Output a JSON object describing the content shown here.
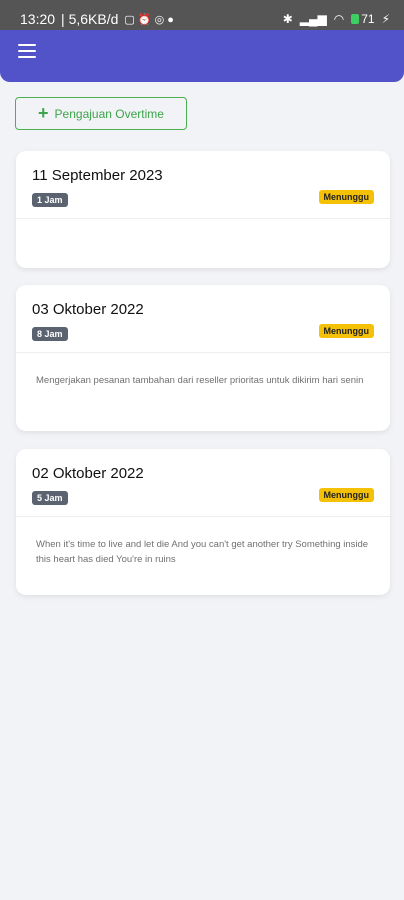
{
  "status_bar": {
    "time": "13:20",
    "network": "| 5,6KB/d",
    "battery": "71"
  },
  "toolbar": {
    "add_label": "Pengajuan Overtime"
  },
  "requests": [
    {
      "date": "11 September 2023",
      "hours": "1 Jam",
      "status": "Menunggu",
      "note": ""
    },
    {
      "date": "03 Oktober 2022",
      "hours": "8 Jam",
      "status": "Menunggu",
      "note": "Mengerjakan pesanan tambahan dari reseller prioritas untuk dikirim hari senin"
    },
    {
      "date": "02 Oktober 2022",
      "hours": "5 Jam",
      "status": "Menunggu",
      "note": "When it's time to live and let die And you can't get another try Something inside this heart has died You're in ruins"
    }
  ],
  "colors": {
    "app_bar": "#5252c9",
    "hours_badge": "#5c6370",
    "status_badge": "#f5c106",
    "add_button": "#4caf50"
  }
}
